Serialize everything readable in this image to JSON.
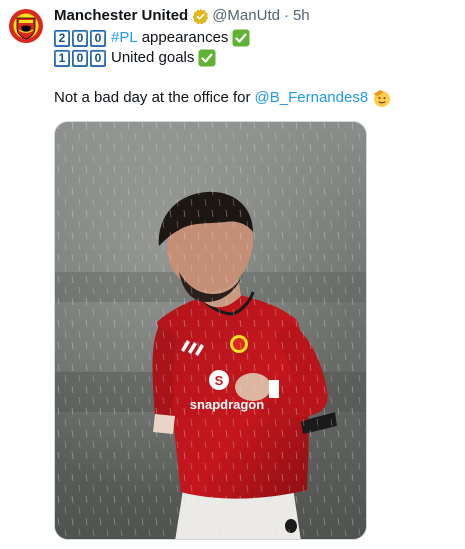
{
  "tweet": {
    "display_name": "Manchester United",
    "handle": "@ManUtd",
    "separator": "·",
    "time": "5h",
    "line1": {
      "keycaps": [
        "2",
        "0",
        "0"
      ],
      "hashtag": "#PL",
      "text": "appearances"
    },
    "line2": {
      "keycaps": [
        "1",
        "0",
        "0"
      ],
      "text": "United goals"
    },
    "line3": {
      "text": "Not a bad day at the office for",
      "mention": "@B_Fernandes8"
    },
    "image": {
      "shirt_sponsor": "snapdragon"
    }
  },
  "icons": {
    "avatar": "manchester-united-crest",
    "verified": "gold-verified-badge",
    "check": "check-mark-button-emoji",
    "face": "saluting-face-emoji"
  },
  "colors": {
    "link": "#1d9bf0",
    "muted": "#536471",
    "verified_gold": "#e2b719",
    "check_green": "#5fb335",
    "shirt_red": "#c4161c"
  }
}
